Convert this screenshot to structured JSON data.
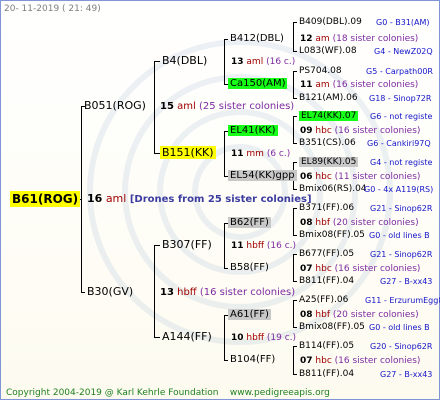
{
  "header": {
    "datetime": "20- 11-2019 ( 21: 49)"
  },
  "footer": {
    "copyright": "Copyright 2004-2019 @ Karl Kehrle Foundation",
    "site": "www.pedigreeapis.org"
  },
  "root": {
    "name": "B61(ROG)",
    "gen_num": "16",
    "gen_unit": "aml",
    "note": "[Drones from 25 sister colonies]"
  },
  "gen1": [
    {
      "name": "B051(ROG)",
      "num": "15",
      "unit": "aml",
      "colonies": "(25 sister colonies)"
    },
    {
      "name": "B30(GV)",
      "num": "13",
      "unit": "hbff",
      "colonies": "(16 sister colonies)"
    }
  ],
  "gen2": [
    {
      "name": "B4(DBL)",
      "num": "13",
      "unit": "aml",
      "colonies": "(16 c.)"
    },
    {
      "name": "B151(KK)",
      "num": "11",
      "unit": "mm",
      "colonies": "(6 c.)"
    },
    {
      "name": "B307(FF)",
      "num": "11",
      "unit": "hbff",
      "colonies": "(16 c.)"
    },
    {
      "name": "A144(FF)",
      "num": "10",
      "unit": "hbff",
      "colonies": "(19 c.)"
    }
  ],
  "gen3": [
    {
      "name": "B412(DBL)",
      "num": "12",
      "unit": "am",
      "colonies": "(18 sister colonies)"
    },
    {
      "name": "Ca150(AM)",
      "num": "11",
      "unit": "am",
      "colonies": "(16 sister colonies)"
    },
    {
      "name": "EL41(KK)",
      "num": "09",
      "unit": "hbc",
      "colonies": "(16 sister colonies)"
    },
    {
      "name": "EL54(KK)gpp",
      "num": "06",
      "unit": "hbc",
      "colonies": "(11 sister colonies)"
    },
    {
      "name": "B62(FF)",
      "num": "08",
      "unit": "hbf",
      "colonies": "(20 sister colonies)"
    },
    {
      "name": "B58(FF)",
      "num": "07",
      "unit": "hbc",
      "colonies": "(16 sister colonies)"
    },
    {
      "name": "A61(FF)",
      "num": "08",
      "unit": "hbf",
      "colonies": "(20 sister colonies)"
    },
    {
      "name": "B104(FF)",
      "num": "07",
      "unit": "hbc",
      "colonies": "(16 sister colonies)"
    }
  ],
  "gen4": [
    {
      "name": "B409(DBL).09",
      "link": "G0 - B31(AM)"
    },
    {
      "name": "L083(WF).08",
      "link": "G4 - NewZ02Q"
    },
    {
      "name": "PS704.08",
      "link": "G5 - Carpath00R"
    },
    {
      "name": "B121(AM).06",
      "link": "G18 - Sinop72R"
    },
    {
      "name": "EL74(KK).07",
      "link": "G6 - not registe"
    },
    {
      "name": "B351(CS).06",
      "link": "G6 - Cankiri97Q"
    },
    {
      "name": "EL89(KK).05",
      "link": "G4 - not registe"
    },
    {
      "name": "Bmix06(RS).04",
      "link": "G0 - 4x A119(RS)"
    },
    {
      "name": "B371(FF).06",
      "link": "G21 - Sinop62R"
    },
    {
      "name": "Bmix08(FF).05",
      "link": "G0 - old lines B"
    },
    {
      "name": "B677(FF).05",
      "link": "G21 - Sinop62R"
    },
    {
      "name": "B811(FF).04",
      "link": "G27 - B-xx43"
    },
    {
      "name": "A25(FF).06",
      "link": "G11 - ErzurumEgg8"
    },
    {
      "name": "Bmix08(FF).05",
      "link": "G0 - old lines B"
    },
    {
      "name": "B114(FF).05",
      "link": "G20 - Sinop62R"
    },
    {
      "name": "B811(FF).04",
      "link": "G27 - B-xx43"
    }
  ]
}
